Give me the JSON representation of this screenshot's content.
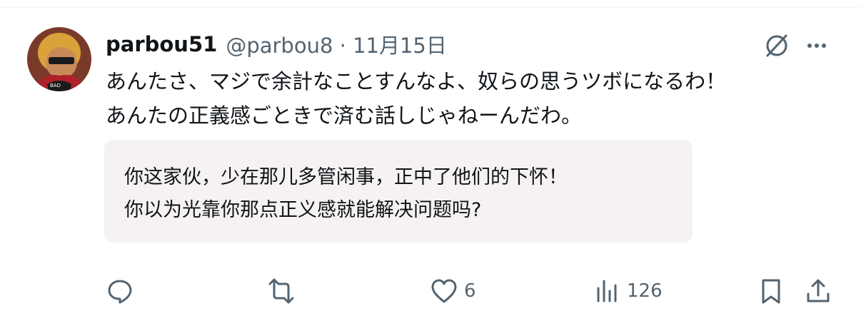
{
  "post": {
    "display_name": "parbou51",
    "handle_meta": "@parbou8 · 11月15日",
    "text_lines": [
      "あんたさ、マジで余計なことすんなよ、奴らの思うツボになるわ！",
      "あんたの正義感ごときで済む話しじゃねーんだわ。"
    ],
    "translation_lines": [
      "你这家伙，少在那儿多管闲事，正中了他们的下怀！",
      "你以为光靠你那点正义感就能解决问题吗?"
    ]
  },
  "actions": {
    "reply_icon": "reply-icon",
    "repost_icon": "repost-icon",
    "like_icon": "heart-icon",
    "like_count": "6",
    "views_icon": "views-icon",
    "views_count": "126",
    "bookmark_icon": "bookmark-icon",
    "share_icon": "share-icon"
  },
  "header_icons": {
    "grok": "grok-icon",
    "more": "more-icon"
  },
  "colors": {
    "text": "#0f1419",
    "secondary": "#536471",
    "translation_bg": "#f7f2f2"
  }
}
